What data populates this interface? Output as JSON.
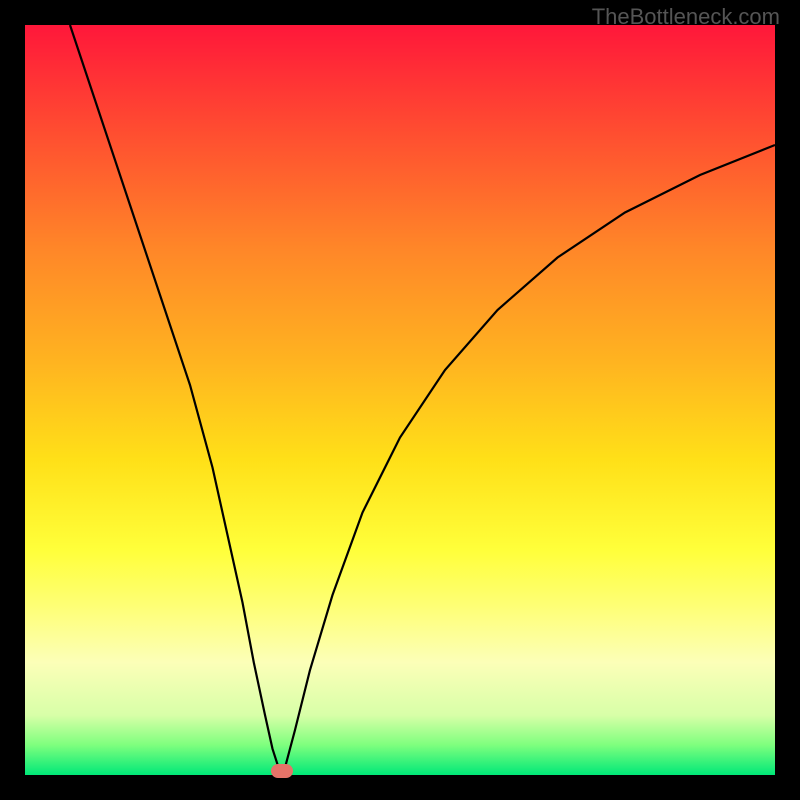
{
  "watermark": "TheBottleneck.com",
  "chart_data": {
    "type": "line",
    "title": "",
    "xlabel": "",
    "ylabel": "",
    "xlim": [
      0,
      100
    ],
    "ylim": [
      0,
      100
    ],
    "background_gradient": {
      "top_color": "#ff173a",
      "bottom_color": "#00e878",
      "description": "vertical gradient red→orange→yellow→green"
    },
    "series": [
      {
        "name": "bottleneck-curve",
        "color": "#000000",
        "x": [
          6,
          10,
          14,
          18,
          22,
          25,
          27,
          29,
          30.5,
          32,
          33,
          33.8,
          34.3,
          34.8,
          36,
          38,
          41,
          45,
          50,
          56,
          63,
          71,
          80,
          90,
          100
        ],
        "values": [
          100,
          88,
          76,
          64,
          52,
          41,
          32,
          23,
          15,
          8,
          3.5,
          1,
          0.2,
          1.5,
          6,
          14,
          24,
          35,
          45,
          54,
          62,
          69,
          75,
          80,
          84
        ]
      }
    ],
    "marker": {
      "name": "optimal-point",
      "x": 34.2,
      "y": 0.6,
      "color": "#e57368"
    }
  }
}
